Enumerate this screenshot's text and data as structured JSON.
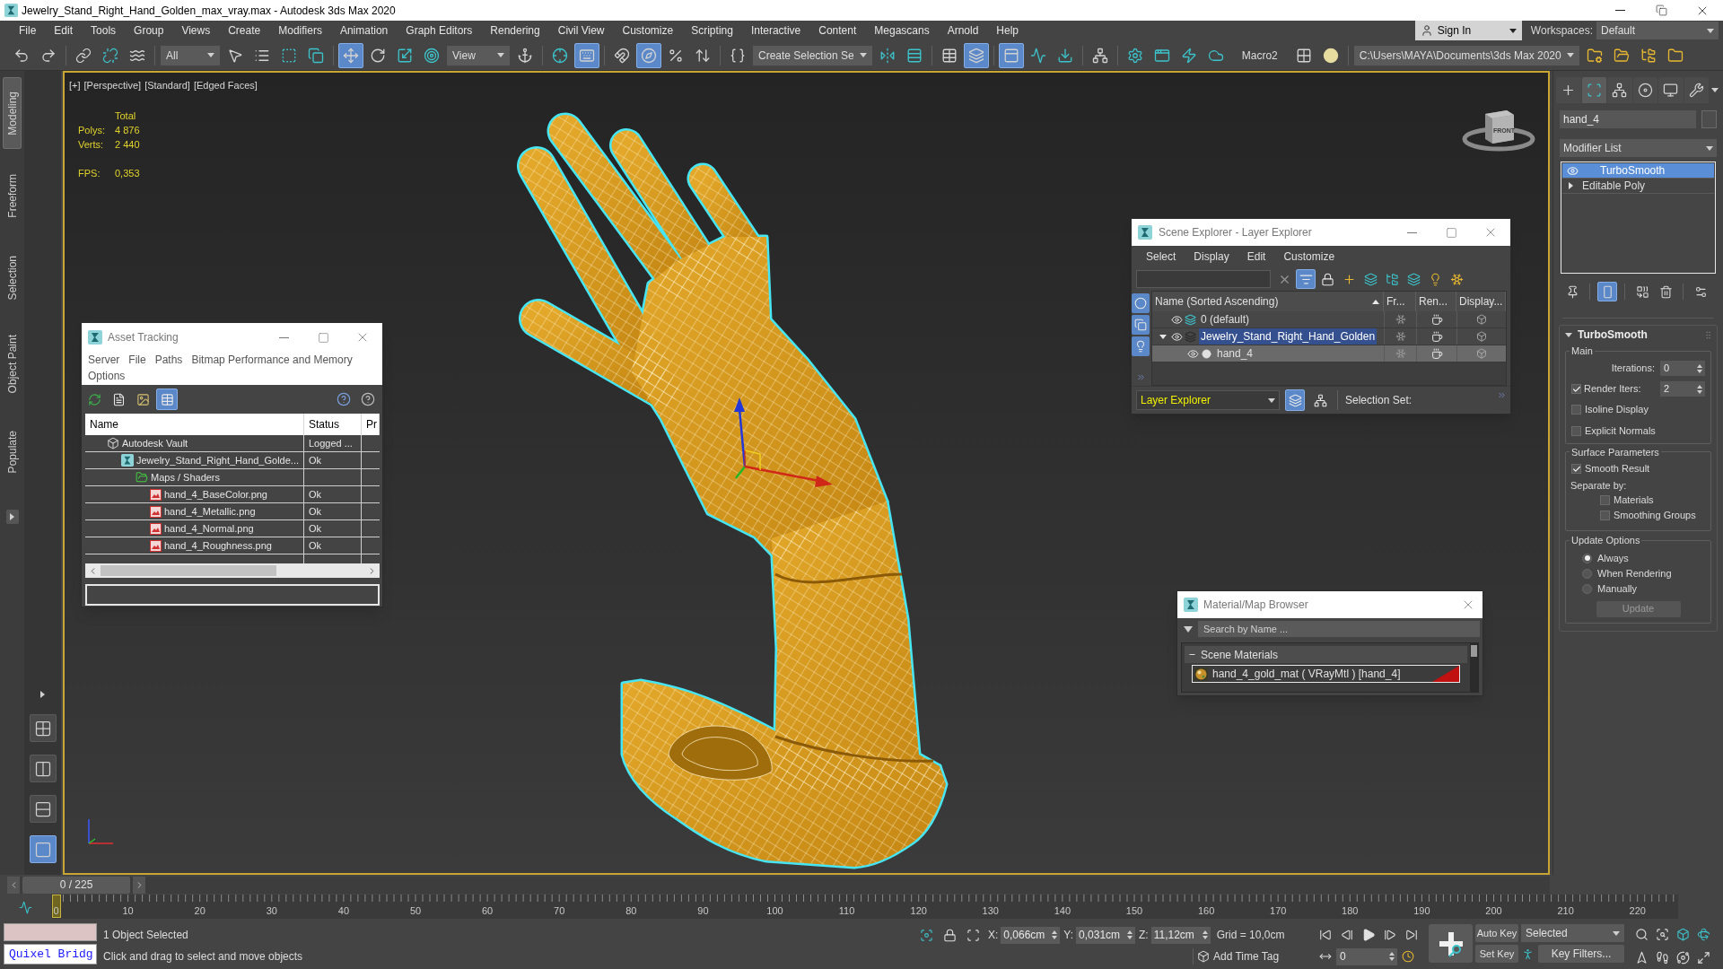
{
  "window": {
    "title": "Jewelry_Stand_Right_Hand_Golden_max_vray.max - Autodesk 3ds Max 2020"
  },
  "menu_bar": [
    "File",
    "Edit",
    "Tools",
    "Group",
    "Views",
    "Create",
    "Modifiers",
    "Animation",
    "Graph Editors",
    "Rendering",
    "Civil View",
    "Customize",
    "Scripting",
    "Interactive",
    "Content",
    "Megascans",
    "Arnold",
    "Help"
  ],
  "account": {
    "label": "Sign In"
  },
  "workspaces": {
    "label": "Workspaces:",
    "value": "Default"
  },
  "main_toolbar": [
    {
      "kind": "button",
      "selected": false
    },
    {
      "kind": "button",
      "selected": false
    },
    {
      "kind": "separator"
    },
    {
      "kind": "button",
      "selected": false
    },
    {
      "kind": "button",
      "selected": false
    },
    {
      "kind": "button",
      "selected": false
    },
    {
      "kind": "separator"
    },
    {
      "kind": "dropdown",
      "value": "All"
    },
    {
      "kind": "button",
      "selected": false
    },
    {
      "kind": "button",
      "selected": false
    },
    {
      "kind": "button",
      "selected": false
    },
    {
      "kind": "button",
      "selected": false
    },
    {
      "kind": "separator"
    },
    {
      "kind": "button",
      "selected": true
    },
    {
      "kind": "button",
      "selected": false
    },
    {
      "kind": "button",
      "selected": false
    },
    {
      "kind": "button",
      "selected": false
    },
    {
      "kind": "dropdown",
      "value": "View"
    },
    {
      "kind": "button",
      "selected": false
    },
    {
      "kind": "separator"
    },
    {
      "kind": "button",
      "selected": false
    },
    {
      "kind": "button",
      "selected": true
    },
    {
      "kind": "separator"
    },
    {
      "kind": "button",
      "selected": false
    },
    {
      "kind": "button",
      "selected": true
    },
    {
      "kind": "button",
      "selected": false
    },
    {
      "kind": "button",
      "selected": false
    },
    {
      "kind": "separator"
    },
    {
      "kind": "button",
      "selected": false
    },
    {
      "kind": "dropdown",
      "value": "Create Selection Se"
    },
    {
      "kind": "button",
      "selected": false
    },
    {
      "kind": "button",
      "selected": false
    },
    {
      "kind": "separator"
    },
    {
      "kind": "button",
      "selected": false
    },
    {
      "kind": "button",
      "selected": true
    },
    {
      "kind": "separator"
    },
    {
      "kind": "button",
      "selected": true
    },
    {
      "kind": "button",
      "selected": false
    },
    {
      "kind": "button",
      "selected": false
    },
    {
      "kind": "separator"
    },
    {
      "kind": "button",
      "selected": false
    },
    {
      "kind": "separator"
    },
    {
      "kind": "button",
      "selected": false
    },
    {
      "kind": "button",
      "selected": false
    },
    {
      "kind": "button",
      "selected": false
    },
    {
      "kind": "button",
      "selected": false
    },
    {
      "kind": "label",
      "text": "Macro2"
    },
    {
      "kind": "button",
      "selected": false
    },
    {
      "kind": "button",
      "selected": false
    },
    {
      "kind": "separator"
    },
    {
      "kind": "dropdown",
      "value": "C:\\Users\\MAYA\\Documents\\3ds Max 2020"
    },
    {
      "kind": "button",
      "selected": false
    },
    {
      "kind": "button",
      "selected": false
    },
    {
      "kind": "button",
      "selected": false
    },
    {
      "kind": "button",
      "selected": false
    }
  ],
  "ribbon_tabs": [
    {
      "label": "Modeling",
      "selected": true
    },
    {
      "label": "Freeform",
      "selected": false
    },
    {
      "label": "Selection",
      "selected": false
    },
    {
      "label": "Object Paint",
      "selected": false
    },
    {
      "label": "Populate",
      "selected": false
    }
  ],
  "viewport_layouts": [
    {
      "selected": false
    },
    {
      "selected": false
    },
    {
      "selected": false
    },
    {
      "selected": true
    }
  ],
  "viewport": {
    "labels": [
      "[+]",
      "[Perspective]",
      "[Standard]",
      "[Edged Faces]"
    ],
    "stats": {
      "heading": "Total",
      "rows": [
        {
          "label": "Polys:",
          "value": "4 876"
        },
        {
          "label": "Verts:",
          "value": "2 440"
        }
      ]
    },
    "fps": {
      "label": "FPS:",
      "value": "0,353"
    },
    "view_cube": {
      "face": "FRONT"
    }
  },
  "asset_tracking": {
    "title": "Asset Tracking",
    "menu": [
      "Server",
      "File",
      "Paths",
      "Bitmap Performance and Memory",
      "Options"
    ],
    "tools": [
      {
        "selected": false
      },
      {
        "selected": false
      },
      {
        "selected": false
      },
      {
        "selected": true
      }
    ],
    "columns": [
      "Name",
      "Status",
      "Pr"
    ],
    "tree": [
      {
        "name": "Autodesk Vault",
        "status": "Logged ...",
        "children": [
          {
            "name": "Jewelry_Stand_Right_Hand_Golde...",
            "status": "Ok",
            "children": [
              {
                "name": "Maps / Shaders",
                "children": [
                  {
                    "name": "hand_4_BaseColor.png",
                    "status": "Ok"
                  },
                  {
                    "name": "hand_4_Metallic.png",
                    "status": "Ok"
                  },
                  {
                    "name": "hand_4_Normal.png",
                    "status": "Ok"
                  },
                  {
                    "name": "hand_4_Roughness.png",
                    "status": "Ok"
                  }
                ]
              }
            ]
          }
        ]
      }
    ]
  },
  "scene_explorer": {
    "title": "Scene Explorer - Layer Explorer",
    "menu": [
      "Select",
      "Display",
      "Edit",
      "Customize"
    ],
    "tools": [
      {
        "selected": true
      },
      {
        "selected": false
      },
      {
        "selected": false
      },
      {
        "selected": false
      },
      {
        "selected": false
      },
      {
        "selected": false
      },
      {
        "selected": false
      },
      {
        "selected": false
      }
    ],
    "side_tools": [
      {
        "selected": true
      },
      {
        "selected": true
      },
      {
        "selected": true
      }
    ],
    "columns": [
      "Name (Sorted Ascending)",
      "Fr...",
      "Ren...",
      "Display..."
    ],
    "layers": [
      {
        "name": "0 (default)",
        "current": true,
        "highlighted": false,
        "selected": false
      },
      {
        "name": "Jewelry_Stand_Right_Hand_Golden",
        "current": false,
        "highlighted": true,
        "selected": false,
        "expanded": true,
        "children": [
          {
            "name": "hand_4",
            "highlighted": false,
            "selected": true
          }
        ]
      }
    ],
    "explorer": "Layer Explorer",
    "modes": [
      {
        "selected": true
      },
      {
        "selected": false
      }
    ],
    "selection_set": "Selection Set:"
  },
  "material_browser": {
    "title": "Material/Map Browser",
    "search": {
      "placeholder": "Search by Name ..."
    },
    "groups": [
      {
        "name": "Scene Materials",
        "expanded": true,
        "items": [
          {
            "name": "hand_4_gold_mat ( VRayMtl ) [hand_4]"
          }
        ]
      }
    ]
  },
  "command_panel": {
    "tabs": [
      {
        "selected": false
      },
      {
        "selected": true
      },
      {
        "selected": false
      },
      {
        "selected": false
      },
      {
        "selected": false
      },
      {
        "selected": false
      }
    ],
    "object_name": "hand_4",
    "modifier_list": "Modifier List",
    "stack": [
      {
        "name": "TurboSmooth",
        "selected": true,
        "enabled": true
      },
      {
        "name": "Editable Poly",
        "selected": false,
        "expanded": false
      }
    ],
    "stack_tools": [
      {
        "selected": false
      },
      {
        "selected": true
      },
      {
        "selected": false
      },
      {
        "selected": false
      },
      {
        "selected": false
      }
    ],
    "rollout": {
      "title": "TurboSmooth",
      "expanded": true,
      "groups": [
        {
          "title": "Main",
          "controls": [
            {
              "kind": "spinner",
              "label": "Iterations:",
              "value": "0"
            },
            {
              "kind": "check_spinner",
              "label": "Render Iters:",
              "checked": true,
              "value": "2"
            },
            {
              "kind": "checkbox",
              "label": "Isoline Display",
              "checked": false
            },
            {
              "kind": "checkbox",
              "label": "Explicit Normals",
              "checked": false
            }
          ]
        },
        {
          "title": "Surface Parameters",
          "controls": [
            {
              "kind": "checkbox",
              "label": "Smooth Result",
              "checked": true
            },
            {
              "kind": "text",
              "label": "Separate by:"
            },
            {
              "kind": "sub_checkbox",
              "label": "Materials",
              "checked": false
            },
            {
              "kind": "sub_checkbox",
              "label": "Smoothing Groups",
              "checked": false
            }
          ]
        },
        {
          "title": "Update Options",
          "controls": [
            {
              "kind": "radio",
              "label": "Always",
              "selected": true
            },
            {
              "kind": "radio",
              "label": "When Rendering",
              "selected": false
            },
            {
              "kind": "radio",
              "label": "Manually",
              "selected": false
            },
            {
              "kind": "button",
              "label": "Update",
              "disabled": true
            }
          ]
        }
      ]
    }
  },
  "time_slider": {
    "value": "0 / 225",
    "level": 0
  },
  "timeline": {
    "ticks": [
      "0",
      "10",
      "20",
      "30",
      "40",
      "50",
      "60",
      "70",
      "80",
      "90",
      "100",
      "110",
      "120",
      "130",
      "140",
      "150",
      "160",
      "170",
      "180",
      "190",
      "200",
      "210",
      "220"
    ]
  },
  "status_bar": {
    "listener": "Quixel Bridg",
    "selection": "1 Object Selected",
    "prompt": "Click and drag to select and move objects",
    "coordinates": [
      {
        "axis": "X:",
        "value": "0,066cm"
      },
      {
        "axis": "Y:",
        "value": "0,031cm"
      },
      {
        "axis": "Z:",
        "value": "11,12cm"
      }
    ],
    "grid": "Grid = 10,0cm",
    "time_tag": "Add Time Tag",
    "frame": "0",
    "auto_key": {
      "label": "Auto Key",
      "on": false
    },
    "set_key": "Set Key",
    "key_set": "Selected",
    "key_filters": "Key Filters..."
  }
}
